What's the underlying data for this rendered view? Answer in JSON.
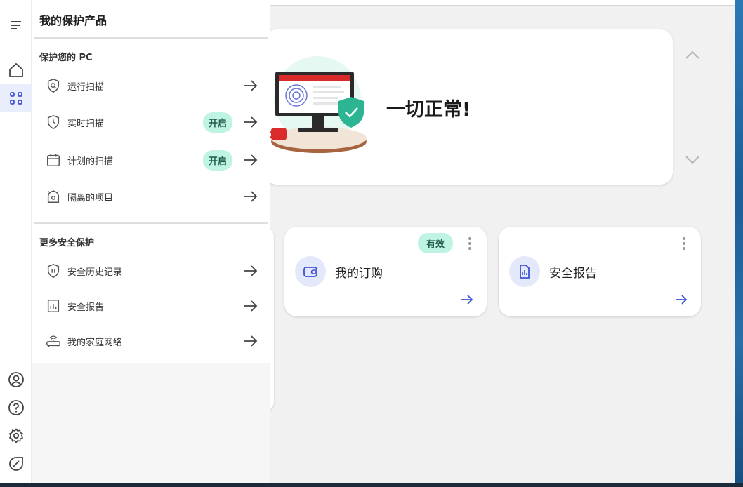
{
  "flyout": {
    "title": "我的保护产品",
    "section1_title": "保护您的 PC",
    "section1_items": [
      {
        "label": "运行扫描",
        "badge": ""
      },
      {
        "label": "实时扫描",
        "badge": "开启"
      },
      {
        "label": "计划的扫描",
        "badge": "开启"
      },
      {
        "label": "隔离的项目",
        "badge": ""
      }
    ],
    "section2_title": "更多安全保护",
    "section2_items": [
      {
        "label": "安全历史记录"
      },
      {
        "label": "安全报告"
      },
      {
        "label": "我的家庭网络"
      }
    ]
  },
  "hero": {
    "status_text": "一切正常!"
  },
  "cards": [
    {
      "title": "我的订购",
      "badge": "有效"
    },
    {
      "title": "安全报告"
    }
  ],
  "colors": {
    "accent": "#3f51d8",
    "badge_bg": "#bff3e3",
    "badge_text": "#1f5c4c",
    "shield": "#2db492",
    "monitor_red": "#d92b2b"
  },
  "icons": {
    "rail": [
      "menu-icon",
      "home-icon",
      "apps-grid-icon",
      "account-icon",
      "help-icon",
      "settings-icon",
      "feedback-icon"
    ],
    "card1": "subscription-icon",
    "card2": "report-icon"
  }
}
